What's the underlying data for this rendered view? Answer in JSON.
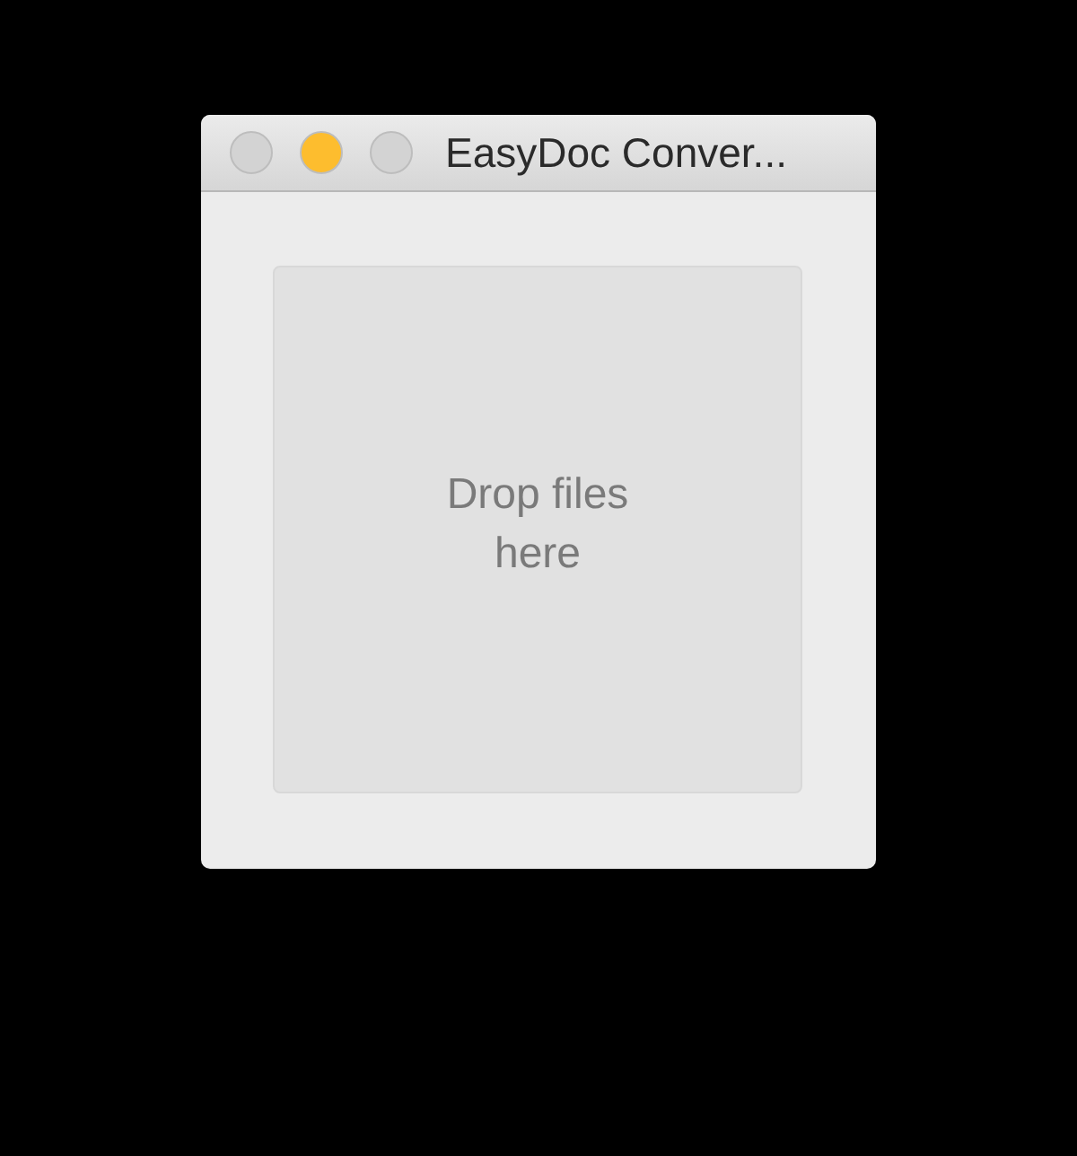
{
  "window": {
    "title": "EasyDoc Conver...",
    "buttons": [
      {
        "color": "#d3d3d3"
      },
      {
        "color": "#fdbd2e"
      },
      {
        "color": "#d3d3d3"
      }
    ]
  },
  "drop_zone": {
    "lines": [
      "Drop files",
      "here"
    ]
  }
}
